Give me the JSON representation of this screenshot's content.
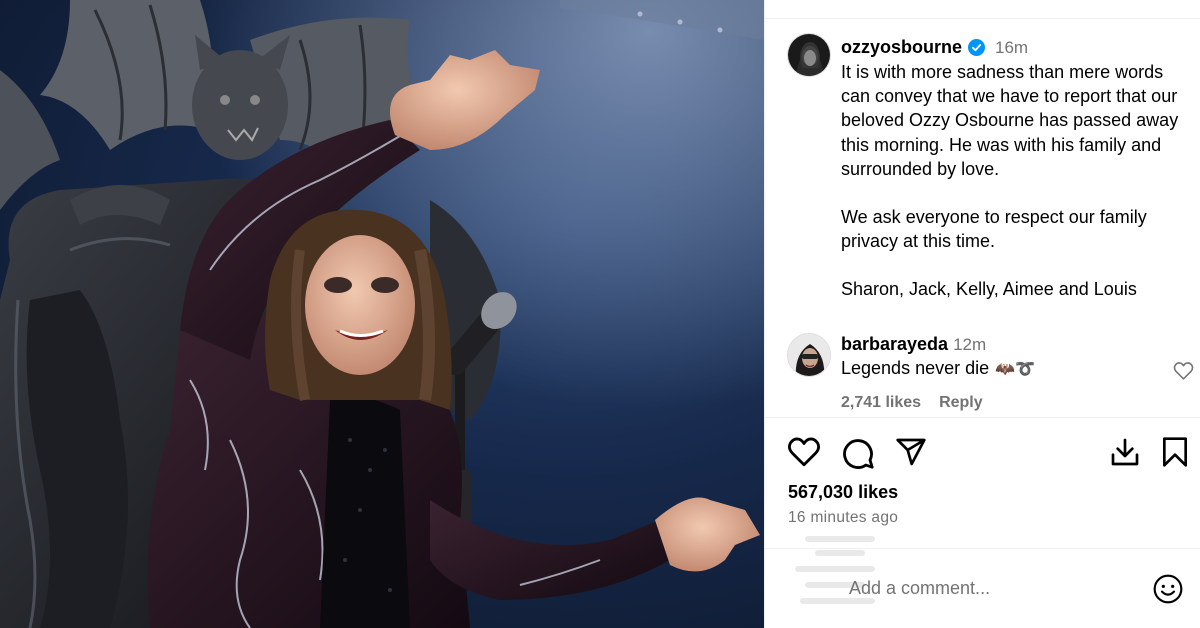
{
  "post": {
    "username": "ozzyosbourne",
    "verified": true,
    "time": "16m",
    "caption": [
      "It is with more sadness than mere words can convey that we have to report that our beloved Ozzy Osbourne has passed away this morning. He was with his family and surrounded by love.",
      "We ask everyone to respect our family privacy at this time.",
      "Sharon, Jack, Kelly, Aimee and Louis"
    ],
    "likes": "567,030 likes",
    "posted_ago": "16 minutes ago"
  },
  "comment": {
    "username": "barbarayeda",
    "time": "12m",
    "text": "Legends never die",
    "emoji": "🦇➰",
    "likes": "2,741 likes",
    "reply_label": "Reply"
  },
  "composer": {
    "placeholder": "Add a comment..."
  },
  "icons": {
    "like": "heart-icon",
    "comment": "comment-icon",
    "share": "share-icon",
    "save_download": "download-icon",
    "bookmark": "bookmark-icon",
    "emoji": "emoji-icon",
    "verified": "verified-badge-icon"
  },
  "colors": {
    "verified_blue": "#0095f6",
    "secondary_text": "#737373",
    "photo_background": "#16284a"
  }
}
